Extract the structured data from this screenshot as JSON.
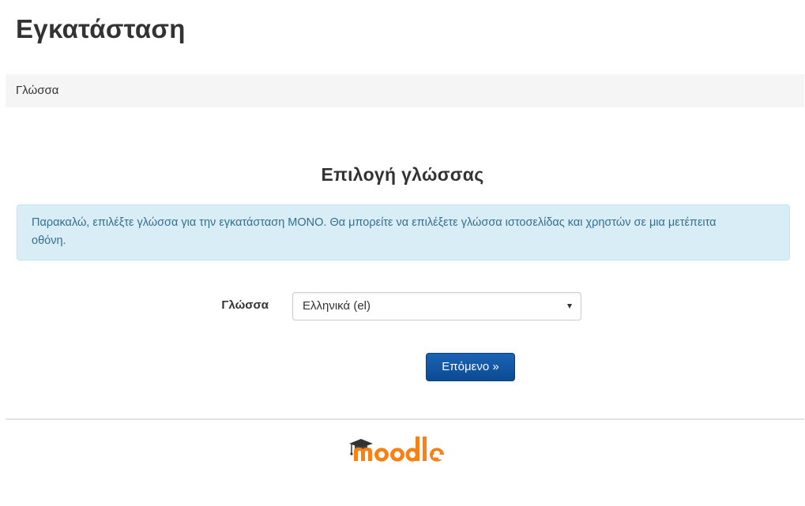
{
  "header": {
    "title": "Εγκατάσταση"
  },
  "breadcrumb": {
    "label": "Γλώσσα"
  },
  "main": {
    "heading": "Επιλογή γλώσσας",
    "info_message": "Παρακαλώ, επιλέξτε γλώσσα για την εγκατάσταση ΜΟΝΟ. Θα μπορείτε να επιλέξετε γλώσσα ιστοσελίδας και χρηστών σε μια μετέπειτα οθόνη.",
    "language_field": {
      "label": "Γλώσσα",
      "selected_value": "Ελληνικά (el)"
    },
    "next_button": "Επόμενο »"
  },
  "footer": {
    "logo_text": "moodle",
    "logo_icon": "graduation-cap-icon"
  },
  "colors": {
    "info_bg": "#d9edf7",
    "info_text": "#31708f",
    "primary_button": "#0f4f99",
    "logo_orange": "#f98012",
    "logo_cap": "#333333"
  }
}
